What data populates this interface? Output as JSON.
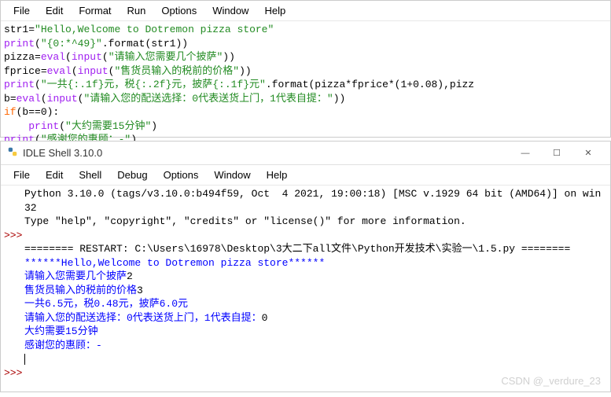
{
  "top_window": {
    "menu": [
      "File",
      "Edit",
      "Format",
      "Run",
      "Options",
      "Window",
      "Help"
    ],
    "code": {
      "l1_var": "str1",
      "l1_str": "\"Hello,Welcome to Dotremon pizza store\"",
      "l2_fn": "print",
      "l2_str": "\"{0:*^49}\"",
      "l2_rest": ".format(str1))",
      "l3_var": "pizza",
      "l3_fn1": "eval",
      "l3_fn2": "input",
      "l3_str": "\"请输入您需要几个披萨\"",
      "l4_var": "fprice",
      "l4_fn1": "eval",
      "l4_fn2": "input",
      "l4_str": "\"售货员输入的税前的价格\"",
      "l5_fn": "print",
      "l5_str": "\"一共{:.1f}元，税{:.2f}元，披萨{:.1f}元\"",
      "l5_rest": ".format(pizza*fprice*(1+0.08),pizz",
      "l6_var": "b",
      "l6_fn1": "eval",
      "l6_fn2": "input",
      "l6_str": "\"请输入您的配送选择：0代表送货上门，1代表自提：\"",
      "l7_kw": "if",
      "l7_rest": "(b==0):",
      "l8_fn": "print",
      "l8_str": "\"大约需要15分钟\"",
      "l9_fn": "print",
      "l9_str": "\"感谢您的惠顾：-\""
    }
  },
  "bottom_window": {
    "title": "IDLE Shell 3.10.0",
    "win_min": "—",
    "win_max": "☐",
    "win_close": "✕",
    "menu": [
      "File",
      "Edit",
      "Shell",
      "Debug",
      "Options",
      "Window",
      "Help"
    ],
    "shell": {
      "banner1": "Python 3.10.0 (tags/v3.10.0:b494f59, Oct  4 2021, 19:00:18) [MSC v.1929 64 bit (AMD64)] on win32",
      "banner2": "Type \"help\", \"copyright\", \"credits\" or \"license()\" for more information.",
      "restart": "======== RESTART: C:\\Users\\16978\\Desktop\\3大二下all文件\\Python开发技术\\实验一\\1.5.py ========",
      "out1": "******Hello,Welcome to Dotremon pizza store******",
      "out2a": "请输入您需要几个披萨",
      "out2b": "2",
      "out3a": "售货员输入的税前的价格",
      "out3b": "3",
      "out4": "一共6.5元，税0.48元，披萨6.0元",
      "out5a": "请输入您的配送选择：0代表送货上门，1代表自提：",
      "out5b": "0",
      "out6": "大约需要15分钟",
      "out7": "感谢您的惠顾：-",
      "prompt": ">>>"
    }
  },
  "watermark": "CSDN @_verdure_23"
}
